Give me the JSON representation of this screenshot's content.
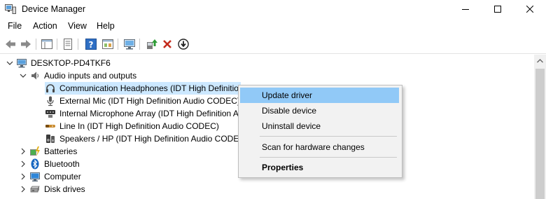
{
  "window": {
    "title": "Device Manager"
  },
  "menu": [
    "File",
    "Action",
    "View",
    "Help"
  ],
  "tree": {
    "root": "DESKTOP-PD4TKF6",
    "audio_group": "Audio inputs and outputs",
    "audio_items": [
      "Communication Headphones (IDT High Definitio",
      "External Mic (IDT High Definition Audio CODEC)",
      "Internal Microphone Array (IDT High Definition A",
      "Line In (IDT High Definition Audio CODEC)",
      "Speakers / HP (IDT High Definition Audio CODEC"
    ],
    "other_groups": [
      "Batteries",
      "Bluetooth",
      "Computer",
      "Disk drives"
    ]
  },
  "context_menu": {
    "update": "Update driver",
    "disable": "Disable device",
    "uninstall": "Uninstall device",
    "scan": "Scan for hardware changes",
    "properties": "Properties"
  },
  "colors": {
    "selection": "#cce8ff",
    "menu_highlight": "#91c9f7",
    "remove_red": "#c42b1c"
  }
}
